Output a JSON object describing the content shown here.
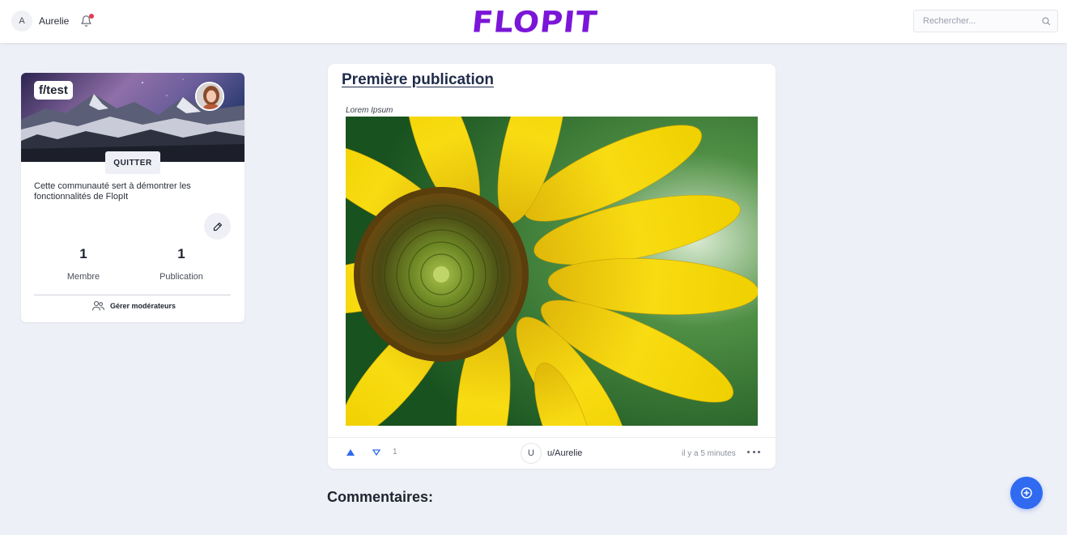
{
  "header": {
    "user_initial": "A",
    "user_name": "Aurelie",
    "logo_text": "FLOPIT",
    "search_placeholder": "Rechercher..."
  },
  "community": {
    "tag": "f/test",
    "quit_label": "QUITTER",
    "description": "Cette communauté sert à démontrer les fonctionnalités de FlopIt",
    "members_count": "1",
    "members_label": "Membre",
    "publications_count": "1",
    "publications_label": "Publication",
    "manage_moderators_label": "Gérer modérateurs"
  },
  "post": {
    "title": "Première publication",
    "description": "Lorem Ipsum",
    "vote_count": "1",
    "author_initial": "U",
    "author": "u/Aurelie",
    "time": "il y a 5 minutes"
  },
  "comments_title": "Commentaires:",
  "colors": {
    "brand": "#7b16d8",
    "accent": "#2f6af0",
    "background": "#eef0f7",
    "notification_dot": "#e5394f"
  },
  "icons": {
    "bell": "bell-icon",
    "search": "search-icon",
    "edit": "pencil-icon",
    "moderators": "users-icon",
    "upvote": "arrow-up-icon",
    "downvote": "arrow-down-icon",
    "more": "more-horizontal-icon",
    "create": "plus-circle-icon"
  }
}
